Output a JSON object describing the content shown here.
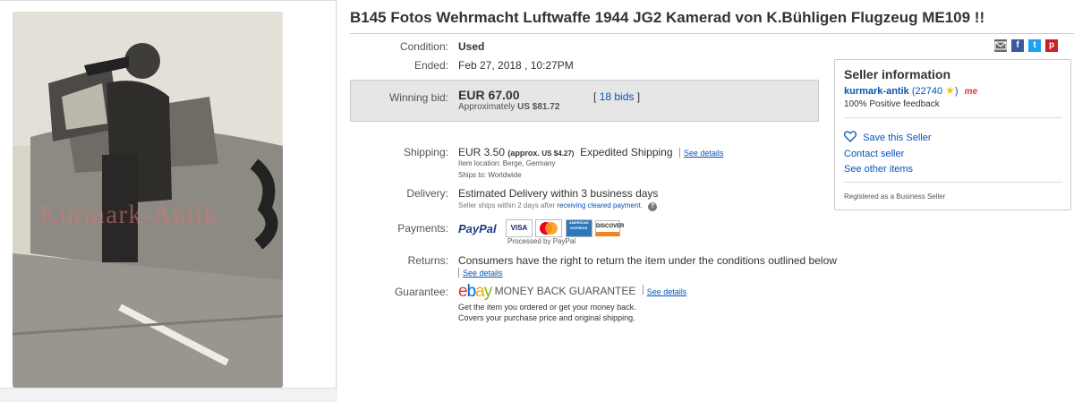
{
  "title": "B145 Fotos Wehrmacht Luftwaffe 1944 JG2 Kamerad von K.Bühligen Flugzeug ME109 !!",
  "photo": {
    "watermark": "Kurmark-Antik"
  },
  "share": {
    "email": "email-icon",
    "facebook": "f",
    "twitter": "t",
    "pinterest": "p"
  },
  "condition": {
    "label": "Condition:",
    "value": "Used"
  },
  "ended": {
    "label": "Ended:",
    "value": "Feb 27, 2018 , 10:27PM"
  },
  "bid": {
    "label": "Winning bid:",
    "value": "EUR 67.00",
    "approx_prefix": "Approximately",
    "approx_value": "US $81.72",
    "bids": "18 bids",
    "bracket_open": "[",
    "bracket_close": "]"
  },
  "shipping": {
    "label": "Shipping:",
    "value": "EUR 3.50",
    "approx": "(approx.",
    "approx_value": "US $4.27)",
    "method": "Expedited Shipping",
    "details_link": "See details",
    "location": "Item location:  Berge, Germany",
    "ships_to": "Ships to:  Worldwide"
  },
  "delivery": {
    "label": "Delivery:",
    "value": "Estimated Delivery within 3 business days",
    "note": "Seller ships within 2 days after",
    "note_link": "receiving cleared payment",
    "note_end": ".",
    "help_icon": "?"
  },
  "payments": {
    "label": "Payments:",
    "paypal": "PayPal",
    "processed": "Processed by PayPal",
    "cards": [
      "VISA",
      "MasterCard",
      "AMERICAN EXPRESS",
      "DISCOVER"
    ]
  },
  "returns": {
    "label": "Returns:",
    "value": "Consumers have the right to return the item under the conditions outlined below",
    "details_link": "See details"
  },
  "guarantee": {
    "label": "Guarantee:",
    "logo": [
      "e",
      "b",
      "a",
      "y"
    ],
    "mbg": "MONEY BACK GUARANTEE",
    "details_link": "See details",
    "line1": "Get the item you ordered or get your money back.",
    "line2": "Covers your purchase price and original shipping."
  },
  "seller": {
    "title": "Seller information",
    "name": "kurmark-antik",
    "score": "22740",
    "paren_open": "(",
    "paren_close": ")",
    "me_badge": "me",
    "feedback": "100% Positive feedback",
    "save": "Save this Seller",
    "contact": "Contact seller",
    "see_other": "See other items",
    "registered": "Registered as a Business Seller"
  },
  "colors": {
    "link": "#0654ba",
    "ebay_e": "#e53238",
    "ebay_b": "#0064d2",
    "ebay_a": "#f5af02",
    "ebay_y": "#86b817"
  }
}
